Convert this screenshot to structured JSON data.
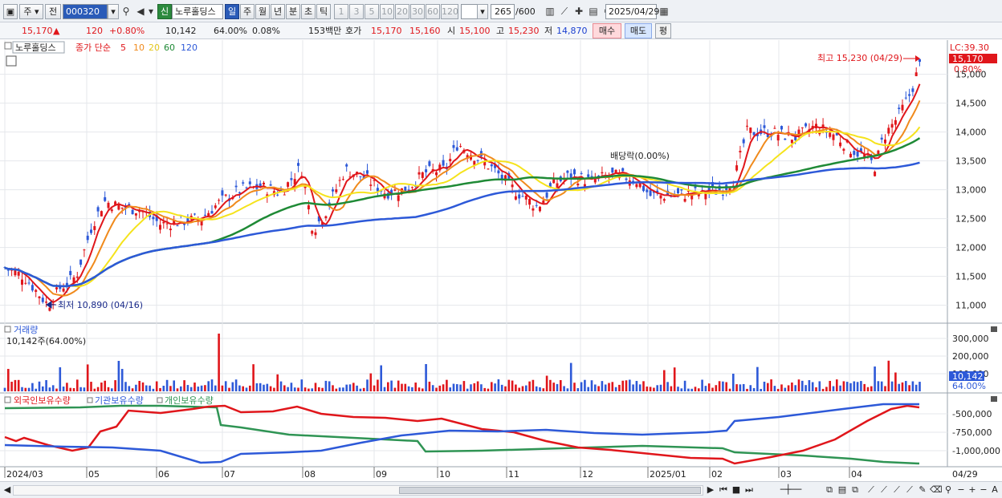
{
  "toolbar": {
    "period_short": "주",
    "market": "전",
    "code": "000320",
    "signal_badge": "신",
    "stock_name": "노루홀딩스",
    "periods": [
      "일",
      "주",
      "월",
      "년",
      "분",
      "초",
      "틱"
    ],
    "intervals": [
      "1",
      "3",
      "5",
      "10",
      "20",
      "30",
      "60",
      "120"
    ],
    "count": "265",
    "count_total": "/600",
    "date": "2025/04/29"
  },
  "quote": {
    "price": "15,170",
    "change": "120",
    "change_pct": "+0.80%",
    "volume": "10,142",
    "vol_ratio": "64.00%",
    "turnover": "0.08%",
    "amount": "153백만",
    "bid_label": "호가",
    "ask": "15,170",
    "bid": "15,160",
    "open_label": "시",
    "open": "15,100",
    "high_label": "고",
    "high": "15,230",
    "low_label": "저",
    "low": "14,870",
    "buy": "매수",
    "sell": "매도",
    "avg": "평"
  },
  "price_panel": {
    "title": "노루홀딩스",
    "ma_label": "종가 단순",
    "ma_periods": [
      "5",
      "10",
      "20",
      "60",
      "120"
    ],
    "ma_colors": [
      "#e0161b",
      "#f08a1c",
      "#f5e31c",
      "#1f8a36",
      "#2d59d8"
    ],
    "lc": "LC:39.30",
    "last_price": "15,170",
    "last_change": "0.80%",
    "high_note": "최고 15,230 (04/29)",
    "low_note": "최저 10,890 (04/16)",
    "dividend_note": "배당락(0.00%)",
    "y_ticks": [
      "15,000",
      "14,500",
      "14,000",
      "13,500",
      "13,000",
      "12,500",
      "12,000",
      "11,500",
      "11,000"
    ]
  },
  "volume_panel": {
    "title": "거래량",
    "value": "10,142주(64.00%)",
    "y_ticks": [
      "300,000",
      "200,000",
      "100,000"
    ],
    "last": "10,142",
    "last_pct": "64.00%"
  },
  "holdings_panel": {
    "legend": [
      "외국인보유수량",
      "기관보유수량",
      "개인보유수량"
    ],
    "colors": [
      "#e0161b",
      "#2d59d8",
      "#2f9454"
    ],
    "y_ticks": [
      "-500,000",
      "-750,000",
      "-1,000,000"
    ]
  },
  "x_axis": [
    "2024/03",
    "05",
    "06",
    "07",
    "08",
    "09",
    "10",
    "11",
    "12",
    "2025/01",
    "02",
    "03",
    "04",
    "04/29"
  ]
}
